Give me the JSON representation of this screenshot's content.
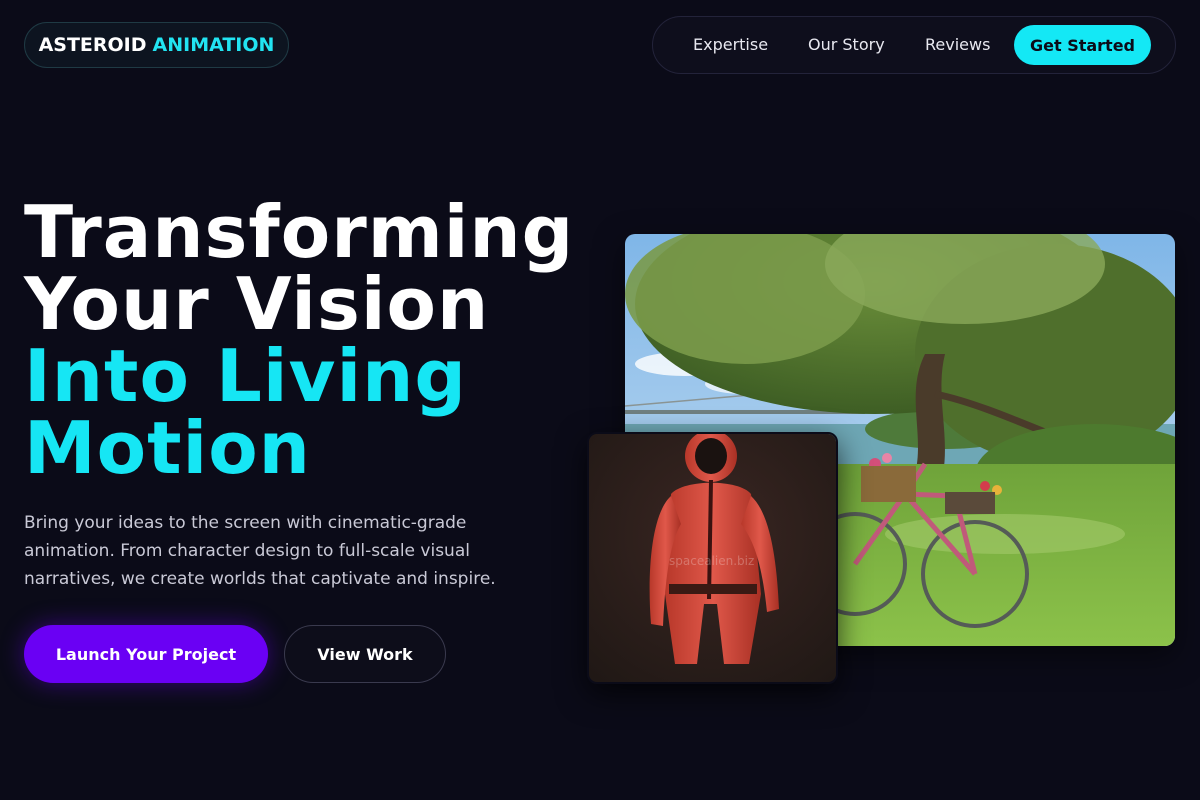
{
  "brand": {
    "name_part1": "ASTEROID",
    "name_part2": "ANIMATION"
  },
  "nav": {
    "links": [
      "Expertise",
      "Our Story",
      "Reviews"
    ],
    "cta": "Get Started"
  },
  "hero": {
    "headline_white": [
      "Transforming",
      "Your Vision"
    ],
    "headline_cyan": [
      "Into Living",
      "Motion"
    ],
    "description": "Bring your ideas to the screen with cinematic-grade animation. From character design to full-scale visual narratives, we create worlds that captivate and inspire.",
    "primary_button": "Launch Your Project",
    "secondary_button": "View Work"
  },
  "images": {
    "small_watermark": "spacealien.biz"
  },
  "colors": {
    "background": "#0b0b18",
    "accent_cyan": "#16e6f4",
    "accent_purple": "#6a00f4"
  }
}
